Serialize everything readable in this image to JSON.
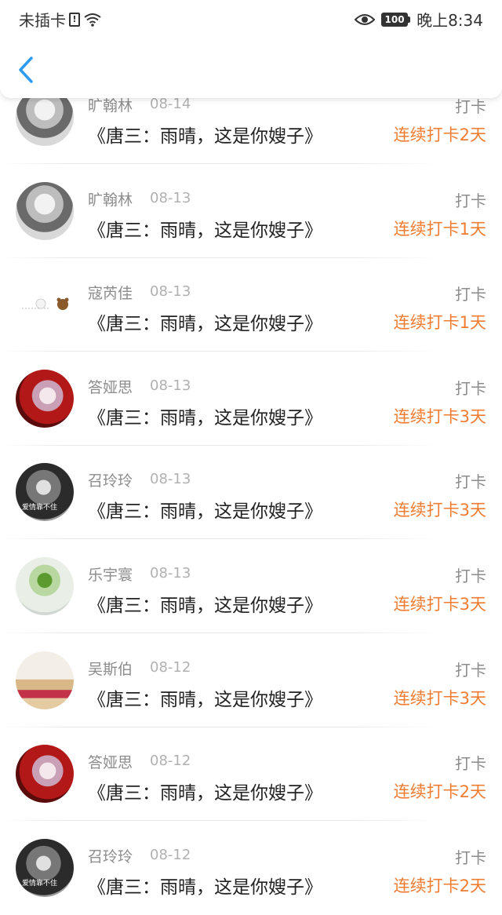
{
  "status_bar": {
    "carrier": "未插卡",
    "battery": "100",
    "time": "晚上8:34",
    "icons": [
      "sim-alert-icon",
      "wifi-icon",
      "eye-icon",
      "battery-icon"
    ]
  },
  "nav": {
    "back_icon": "chevron-left-icon",
    "accent_color": "#2d9cf0"
  },
  "colors": {
    "streak": "#f07c32",
    "name": "#8c8c8c",
    "title": "#222222"
  },
  "records": [
    {
      "name": "旷翰林",
      "date": "08-14",
      "book": "《唐三：雨晴，这是你嫂子》",
      "label": "打卡",
      "streak": "连续打卡2天",
      "avatar": "gray"
    },
    {
      "name": "旷翰林",
      "date": "08-13",
      "book": "《唐三：雨晴，这是你嫂子》",
      "label": "打卡",
      "streak": "连续打卡1天",
      "avatar": "gray"
    },
    {
      "name": "寇芮佳",
      "date": "08-13",
      "book": "《唐三：雨晴，这是你嫂子》",
      "label": "打卡",
      "streak": "连续打卡1天",
      "avatar": "plain"
    },
    {
      "name": "答娅思",
      "date": "08-13",
      "book": "《唐三：雨晴，这是你嫂子》",
      "label": "打卡",
      "streak": "连续打卡3天",
      "avatar": "red"
    },
    {
      "name": "召玲玲",
      "date": "08-13",
      "book": "《唐三：雨晴，这是你嫂子》",
      "label": "打卡",
      "streak": "连续打卡3天",
      "avatar": "dark",
      "avatar_caption": "爱情靠不住"
    },
    {
      "name": "乐宇寰",
      "date": "08-13",
      "book": "《唐三：雨晴，这是你嫂子》",
      "label": "打卡",
      "streak": "连续打卡3天",
      "avatar": "leaf"
    },
    {
      "name": "吴斯伯",
      "date": "08-12",
      "book": "《唐三：雨晴，这是你嫂子》",
      "label": "打卡",
      "streak": "连续打卡3天",
      "avatar": "beach"
    },
    {
      "name": "答娅思",
      "date": "08-12",
      "book": "《唐三：雨晴，这是你嫂子》",
      "label": "打卡",
      "streak": "连续打卡2天",
      "avatar": "red"
    },
    {
      "name": "召玲玲",
      "date": "08-12",
      "book": "《唐三：雨晴，这是你嫂子》",
      "label": "打卡",
      "streak": "连续打卡2天",
      "avatar": "dark",
      "avatar_caption": "爱情靠不住"
    }
  ]
}
